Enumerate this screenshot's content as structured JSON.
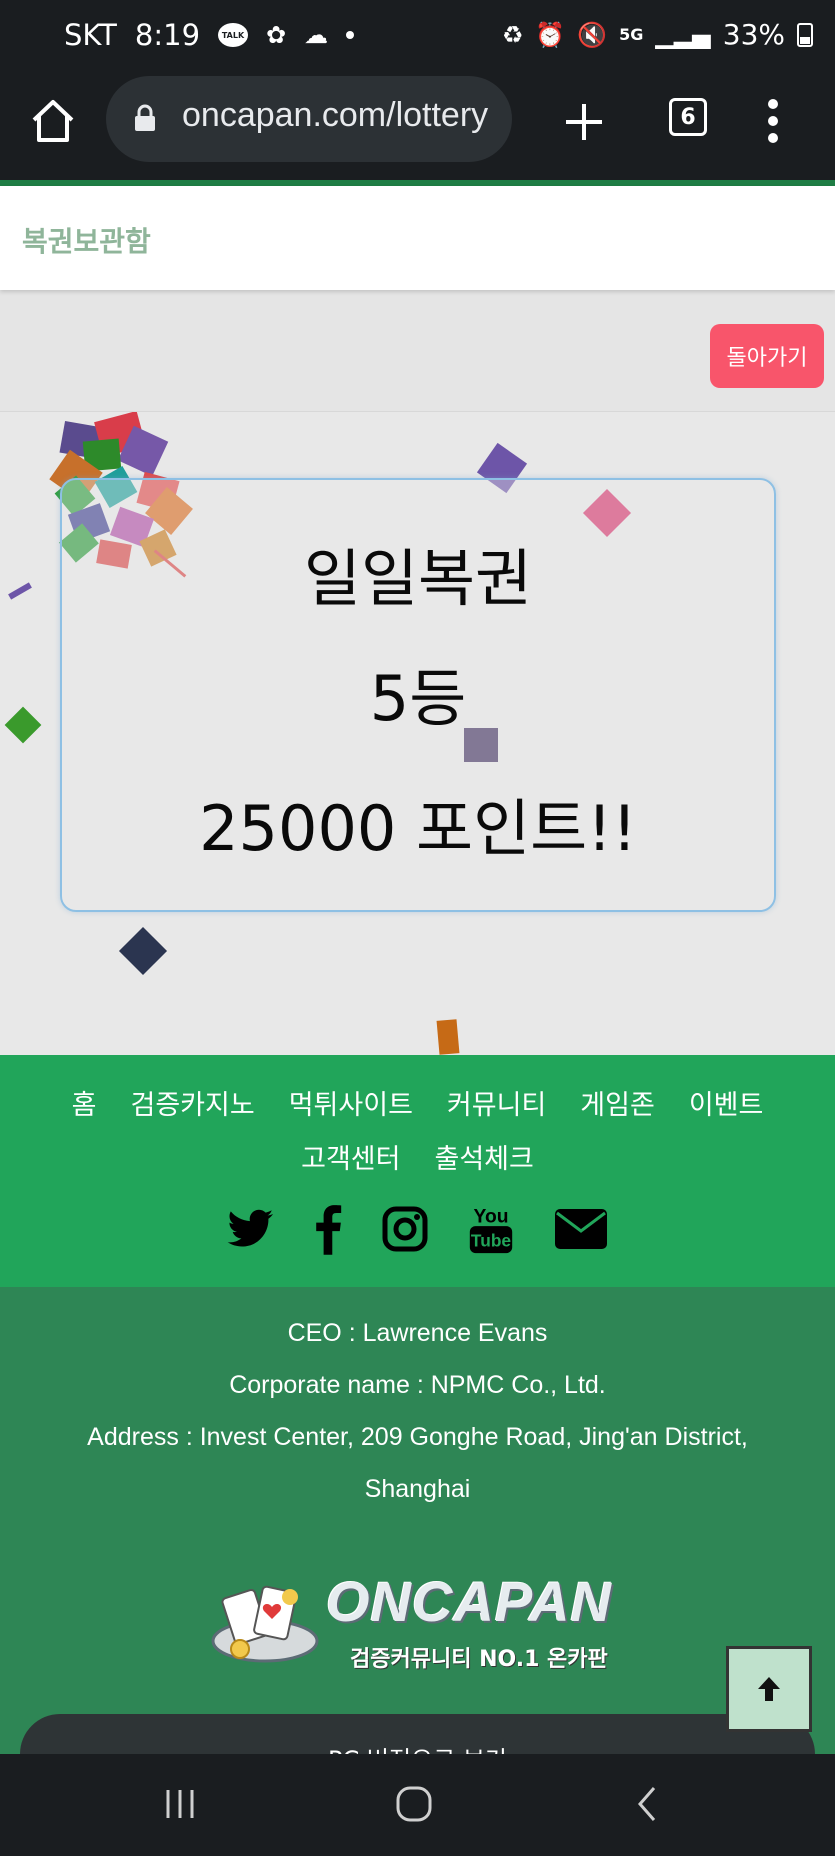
{
  "status_bar": {
    "carrier": "SKT",
    "time": "8:19",
    "talk_label": "TALK",
    "battery": "33%",
    "network": "5G"
  },
  "browser": {
    "url": "oncapan.com/lottery",
    "tab_count": "6"
  },
  "page": {
    "title": "복권보관함",
    "back_button": "돌아가기"
  },
  "lottery_result": {
    "name": "일일복권",
    "rank": "5등",
    "prize": "25000 포인트!!"
  },
  "nav": {
    "row1": [
      "홈",
      "검증카지노",
      "먹튀사이트",
      "커뮤니티",
      "게임존",
      "이벤트"
    ],
    "row2": [
      "고객센터",
      "출석체크"
    ],
    "social": [
      "twitter-icon",
      "facebook-icon",
      "instagram-icon",
      "youtube-icon",
      "mail-icon"
    ]
  },
  "footer": {
    "ceo": "CEO : Lawrence Evans",
    "corporate": "Corporate name : NPMC Co., Ltd.",
    "address_line1": "Address : Invest Center, 209 Gonghe Road, Jing'an District,",
    "address_line2": "Shanghai",
    "logo_text": "ONCAPAN",
    "logo_sub": "검증커뮤니티 NO.1 온카판",
    "pc_view": "PC 버전으로 보기"
  },
  "colors": {
    "brand_green": "#21a55a",
    "footer_green": "#2e8655",
    "back_button": "#f8556b",
    "title_green": "#8fb59a"
  }
}
